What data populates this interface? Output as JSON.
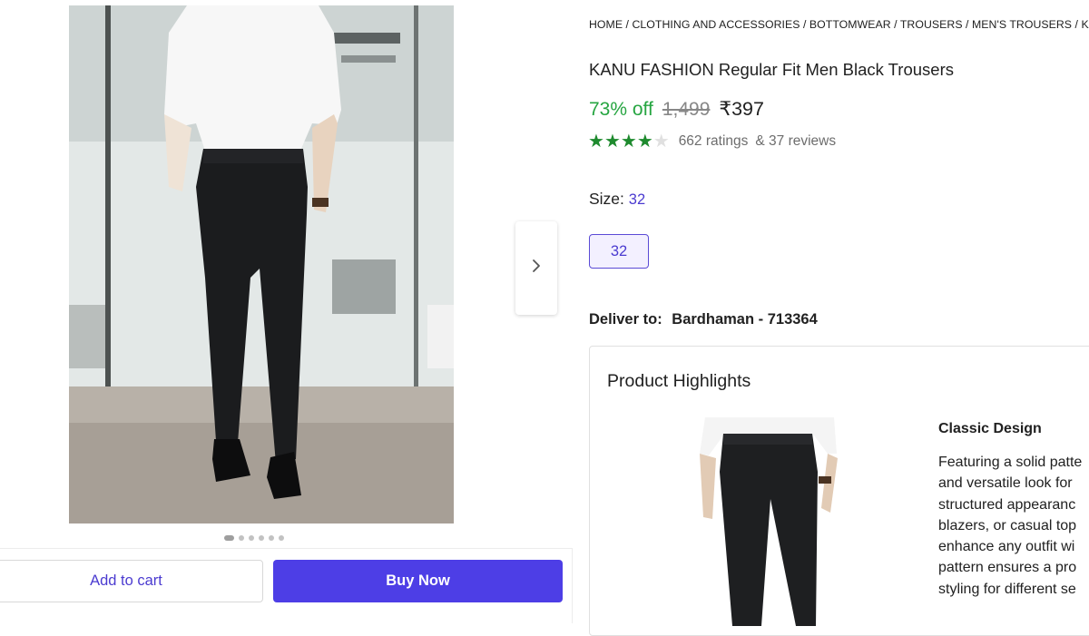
{
  "breadcrumb": "HOME / CLOTHING AND ACCESSORIES / BOTTOMWEAR / TROUSERS / MEN'S TROUSERS / KANU FASHION",
  "product": {
    "title": "KANU FASHION Regular Fit Men Black Trousers",
    "discount": "73% off",
    "mrp": "1,499",
    "price": "₹397",
    "rating_value": 4,
    "rating_max": 5,
    "ratings_text": "662 ratings",
    "reviews_text": "& 37 reviews"
  },
  "size": {
    "label": "Size:",
    "selected": "32",
    "options": [
      "32"
    ]
  },
  "delivery": {
    "label": "Deliver to:",
    "location": "Bardhaman - 713364"
  },
  "highlights": {
    "title": "Product Highlights",
    "item_heading": "Classic Design",
    "item_lines": [
      "Featuring a solid patte",
      "and versatile look for",
      "structured appearanc",
      "blazers, or casual top",
      "enhance any outfit wi",
      "pattern ensures a pro",
      "styling for different se"
    ]
  },
  "gallery": {
    "image_count": 6,
    "active_index": 0
  },
  "actions": {
    "add_to_cart": "Add to cart",
    "buy_now": "Buy Now"
  },
  "icons": {
    "next": "chevron-right-icon",
    "star": "star-icon"
  },
  "colors": {
    "brand": "#4d3ee6",
    "discount": "#26a541",
    "stars": "#1e8a2e"
  }
}
